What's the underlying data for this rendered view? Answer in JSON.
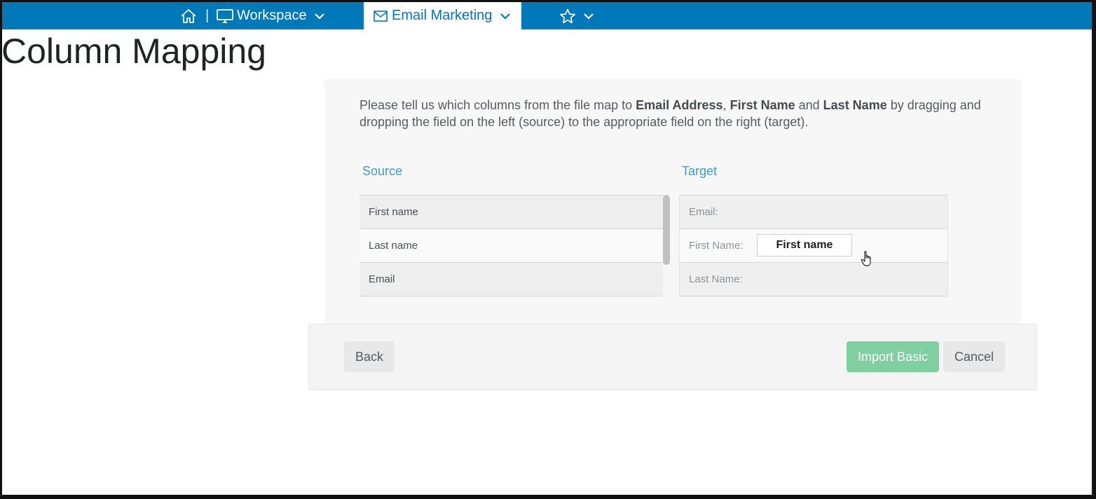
{
  "nav": {
    "home_icon": "home-icon",
    "separator": "|",
    "workspace_label": "Workspace",
    "email_marketing_label": "Email Marketing",
    "favorites_icon": "star-icon",
    "bar_color": "#0079ba"
  },
  "page": {
    "title": "Column Mapping"
  },
  "instructions": {
    "part1": "Please tell us which columns from the file map to ",
    "bold1": "Email Address",
    "part2": ", ",
    "bold2": "First Name",
    "part3": " and ",
    "bold3": "Last Name",
    "part4": " by dragging and dropping the field on the left (source) to the appropriate field on the right (target)."
  },
  "source": {
    "title": "Source",
    "items": [
      {
        "label": "First name"
      },
      {
        "label": "Last name"
      },
      {
        "label": "Email"
      }
    ]
  },
  "target": {
    "title": "Target",
    "fields": [
      {
        "label": "Email:",
        "mapped": ""
      },
      {
        "label": "First Name:",
        "mapped": "First name"
      },
      {
        "label": "Last Name:",
        "mapped": ""
      }
    ]
  },
  "footer": {
    "back_label": "Back",
    "import_label": "Import Basic",
    "cancel_label": "Cancel",
    "import_color": "#7fcfa0"
  }
}
